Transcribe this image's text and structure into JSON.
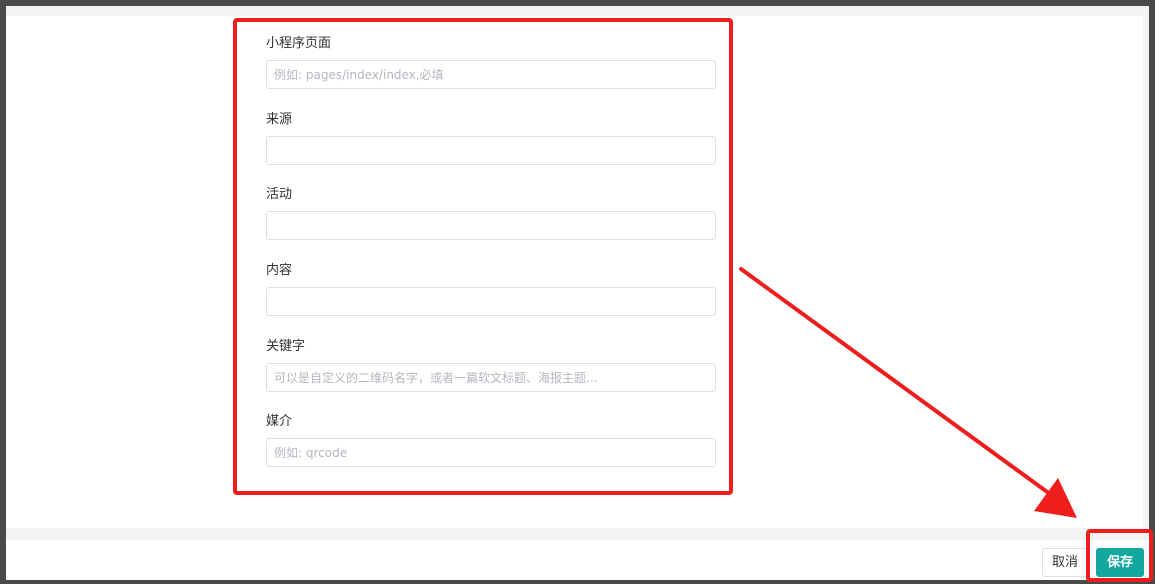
{
  "form": {
    "fields": [
      {
        "label": "小程序页面",
        "value": "",
        "placeholder": "例如: pages/index/index,必填"
      },
      {
        "label": "来源",
        "value": "",
        "placeholder": ""
      },
      {
        "label": "活动",
        "value": "",
        "placeholder": ""
      },
      {
        "label": "内容",
        "value": "",
        "placeholder": ""
      },
      {
        "label": "关键字",
        "value": "",
        "placeholder": "可以是自定义的二维码名字，或者一篇软文标题、海报主题..."
      },
      {
        "label": "媒介",
        "value": "",
        "placeholder": "例如: qrcode"
      }
    ]
  },
  "footer": {
    "cancel_label": "取消",
    "save_label": "保存"
  },
  "colors": {
    "primary": "#13a89e",
    "annotation": "#f01d1d"
  }
}
